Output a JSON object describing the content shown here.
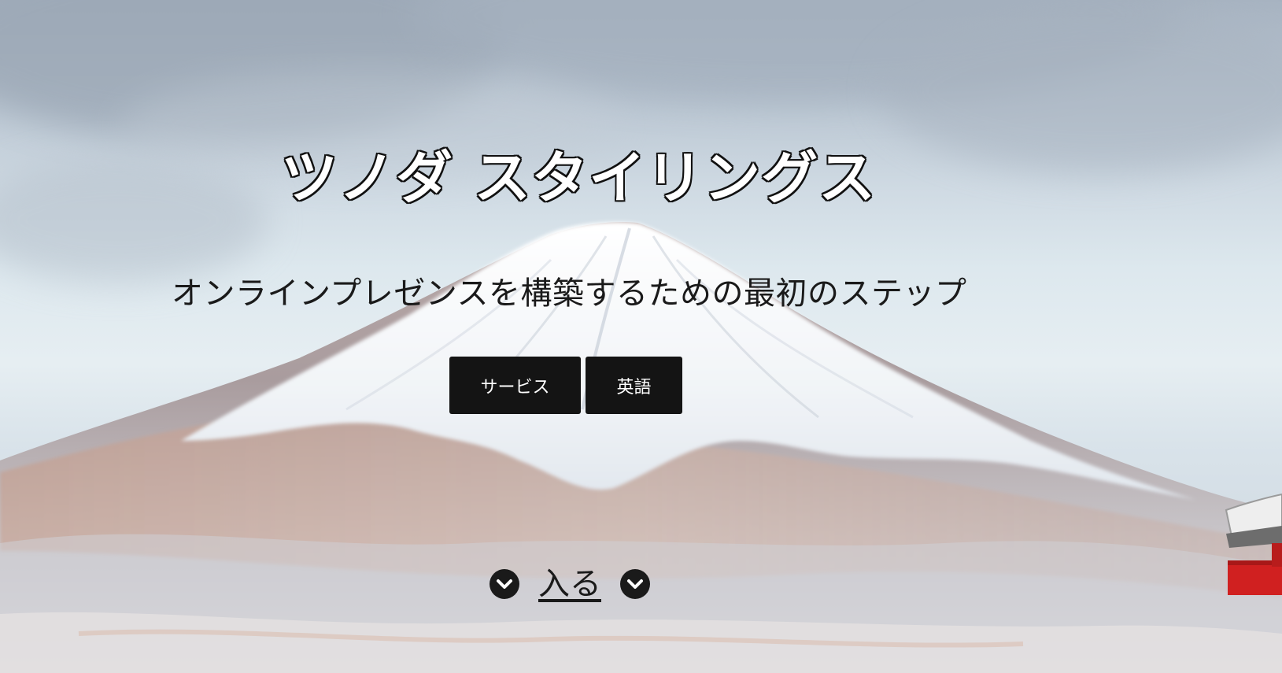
{
  "hero": {
    "title": "ツノダ スタイリングス",
    "subtitle": "オンラインプレゼンスを構築するための最初のステップ",
    "buttons": {
      "services_label": "サービス",
      "english_label": "英語"
    },
    "enter": {
      "label": "入る",
      "icon": "chevron-down-circle-icon"
    },
    "background": "Mount Fuji with torii gate"
  },
  "colors": {
    "button_bg": "#141414",
    "button_text": "#ffffff",
    "text_dark": "#1a1a1a",
    "torii_red": "#d02020"
  }
}
